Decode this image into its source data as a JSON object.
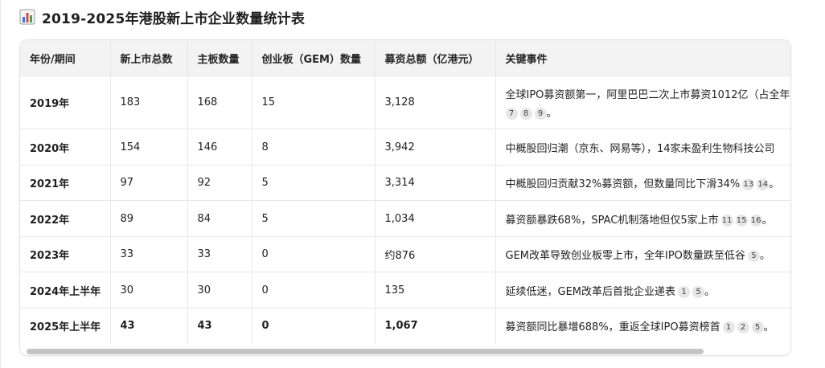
{
  "title": "2019-2025年港股新上市企业数量统计表",
  "icon": "bar-chart-icon",
  "table": {
    "headers": [
      "年份/期间",
      "新上市总数",
      "主板数量",
      "创业板（GEM）数量",
      "募资总额（亿港元）",
      "关键事件"
    ],
    "rows": [
      {
        "period": "2019年",
        "total": "183",
        "main": "168",
        "gem": "15",
        "raise": "3,128",
        "event_line1": "全球IPO募资额第一，阿里巴巴二次上市募资1012亿（占全年",
        "event_line2": "",
        "cites": [
          "7",
          "8",
          "9"
        ],
        "event_end": "。"
      },
      {
        "period": "2020年",
        "total": "154",
        "main": "146",
        "gem": "8",
        "raise": "3,942",
        "event_line1": "中概股回归潮（京东、网易等），14家未盈利生物科技公司",
        "cites": [],
        "event_end": ""
      },
      {
        "period": "2021年",
        "total": "97",
        "main": "92",
        "gem": "5",
        "raise": "3,314",
        "event_line1": "中概股回归贡献32%募资额，但数量同比下滑34%",
        "cites": [
          "13",
          "14"
        ],
        "event_end": "。"
      },
      {
        "period": "2022年",
        "total": "89",
        "main": "84",
        "gem": "5",
        "raise": "1,034",
        "event_line1": "募资额暴跌68%，SPAC机制落地但仅5家上市",
        "cites": [
          "11",
          "15",
          "16"
        ],
        "event_end": "。"
      },
      {
        "period": "2023年",
        "total": "33",
        "main": "33",
        "gem": "0",
        "raise": "约876",
        "event_line1": "GEM改革导致创业板零上市，全年IPO数量跌至低谷",
        "cites": [
          "5"
        ],
        "event_end": "。"
      },
      {
        "period": "2024年上半年",
        "total": "30",
        "main": "30",
        "gem": "0",
        "raise": "135",
        "event_line1": "延续低迷，GEM改革后首批企业递表",
        "cites": [
          "1",
          "5"
        ],
        "event_end": "。"
      },
      {
        "period": "2025年上半年",
        "total": "43",
        "main": "43",
        "gem": "0",
        "raise": "1,067",
        "event_line1": "募资额同比暴增688%，重返全球IPO募资榜首",
        "cites": [
          "1",
          "2",
          "5"
        ],
        "event_end": "。"
      }
    ]
  },
  "colors": {
    "header_bg": "#f3f3f3",
    "border": "#e8e8e8",
    "cite_bg": "#e6e6e6",
    "scroll_thumb": "#c4c4c4"
  }
}
